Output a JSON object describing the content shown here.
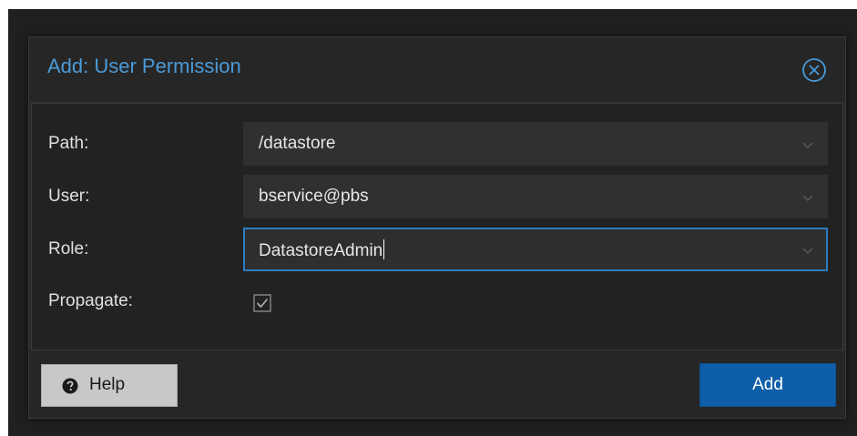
{
  "dialog": {
    "title": "Add: User Permission",
    "close_icon": "close-circle-icon"
  },
  "form": {
    "path": {
      "label": "Path:",
      "value": "/datastore"
    },
    "user": {
      "label": "User:",
      "value": "bservice@pbs"
    },
    "role": {
      "label": "Role:",
      "value": "DatastoreAdmin"
    },
    "propagate": {
      "label": "Propagate:",
      "checked": true
    }
  },
  "footer": {
    "help_label": "Help",
    "help_icon": "question-circle-icon",
    "add_label": "Add"
  },
  "colors": {
    "title": "#4a9ad8",
    "accent": "#2d7cc4",
    "primary_button": "#0f5ea8",
    "dialog_bg": "#2a2a2a"
  }
}
